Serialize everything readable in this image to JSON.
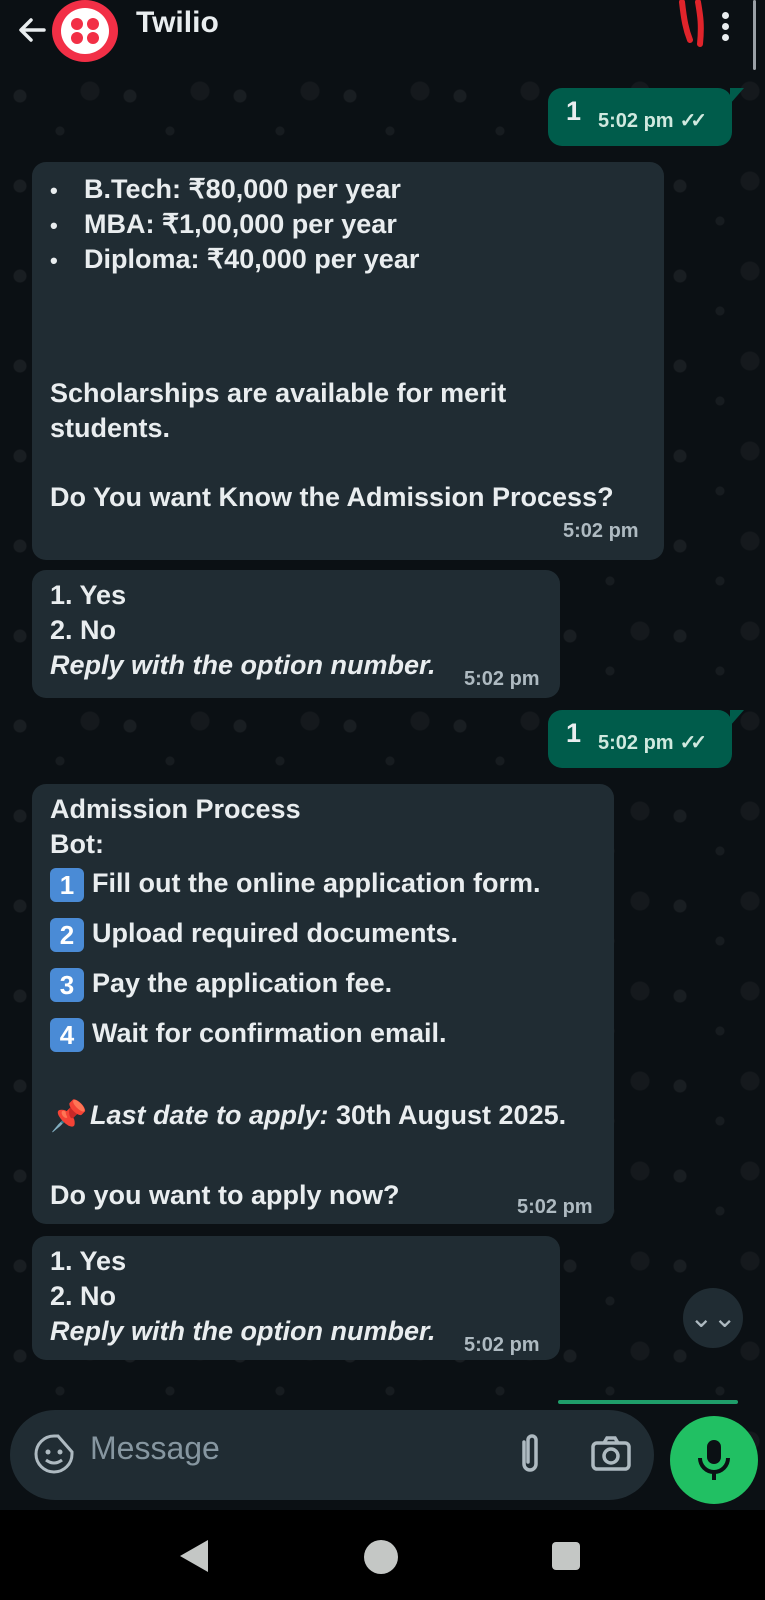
{
  "header": {
    "title": "Twilio",
    "menu_icon": "more-vert-icon",
    "back_icon": "arrow-back-icon"
  },
  "colors": {
    "accent": "#21c063",
    "outgoing_bubble": "#005c4b",
    "incoming_bubble": "#202c33",
    "brand_red": "#f22f46"
  },
  "messages": {
    "m1": {
      "text": "1",
      "time": "5:02 pm",
      "ticks": "✓✓"
    },
    "m2": {
      "bullets": [
        "B.Tech: ₹80,000 per year",
        "MBA: ₹1,00,000 per year",
        "Diploma: ₹40,000 per year"
      ],
      "line1": "Scholarships are available for merit",
      "line2": "students.",
      "line3": "Do You want Know the Admission Process?",
      "time": "5:02 pm"
    },
    "m3": {
      "opt1": "1. Yes",
      "opt2": "2. No",
      "hint": "Reply with the option number.",
      "time": "5:02 pm"
    },
    "m4": {
      "text": "1",
      "time": "5:02 pm",
      "ticks": "✓✓"
    },
    "m5": {
      "title": "Admission Process",
      "subtitle": "Bot:",
      "steps": [
        {
          "num": "1",
          "text": "Fill out the online application form."
        },
        {
          "num": "2",
          "text": "Upload required documents."
        },
        {
          "num": "3",
          "text": "Pay the application fee."
        },
        {
          "num": "4",
          "text": "Wait for confirmation email."
        }
      ],
      "pin": "📌",
      "deadline_label": "Last date to apply:",
      "deadline_value": " 30th August 2025.",
      "question": "Do you want to apply now?",
      "time": "5:02 pm"
    },
    "m6": {
      "opt1": "1. Yes",
      "opt2": "2. No",
      "hint": "Reply with the option number.",
      "time": "5:02 pm"
    }
  },
  "composer": {
    "placeholder": "Message",
    "emoji_icon": "sticker-icon",
    "attach_icon": "paperclip-icon",
    "camera_icon": "camera-icon",
    "mic_icon": "mic-icon"
  },
  "scroll_down_icon": "double-chevron-down-icon",
  "scroll_down_glyph": "⌄⌄"
}
